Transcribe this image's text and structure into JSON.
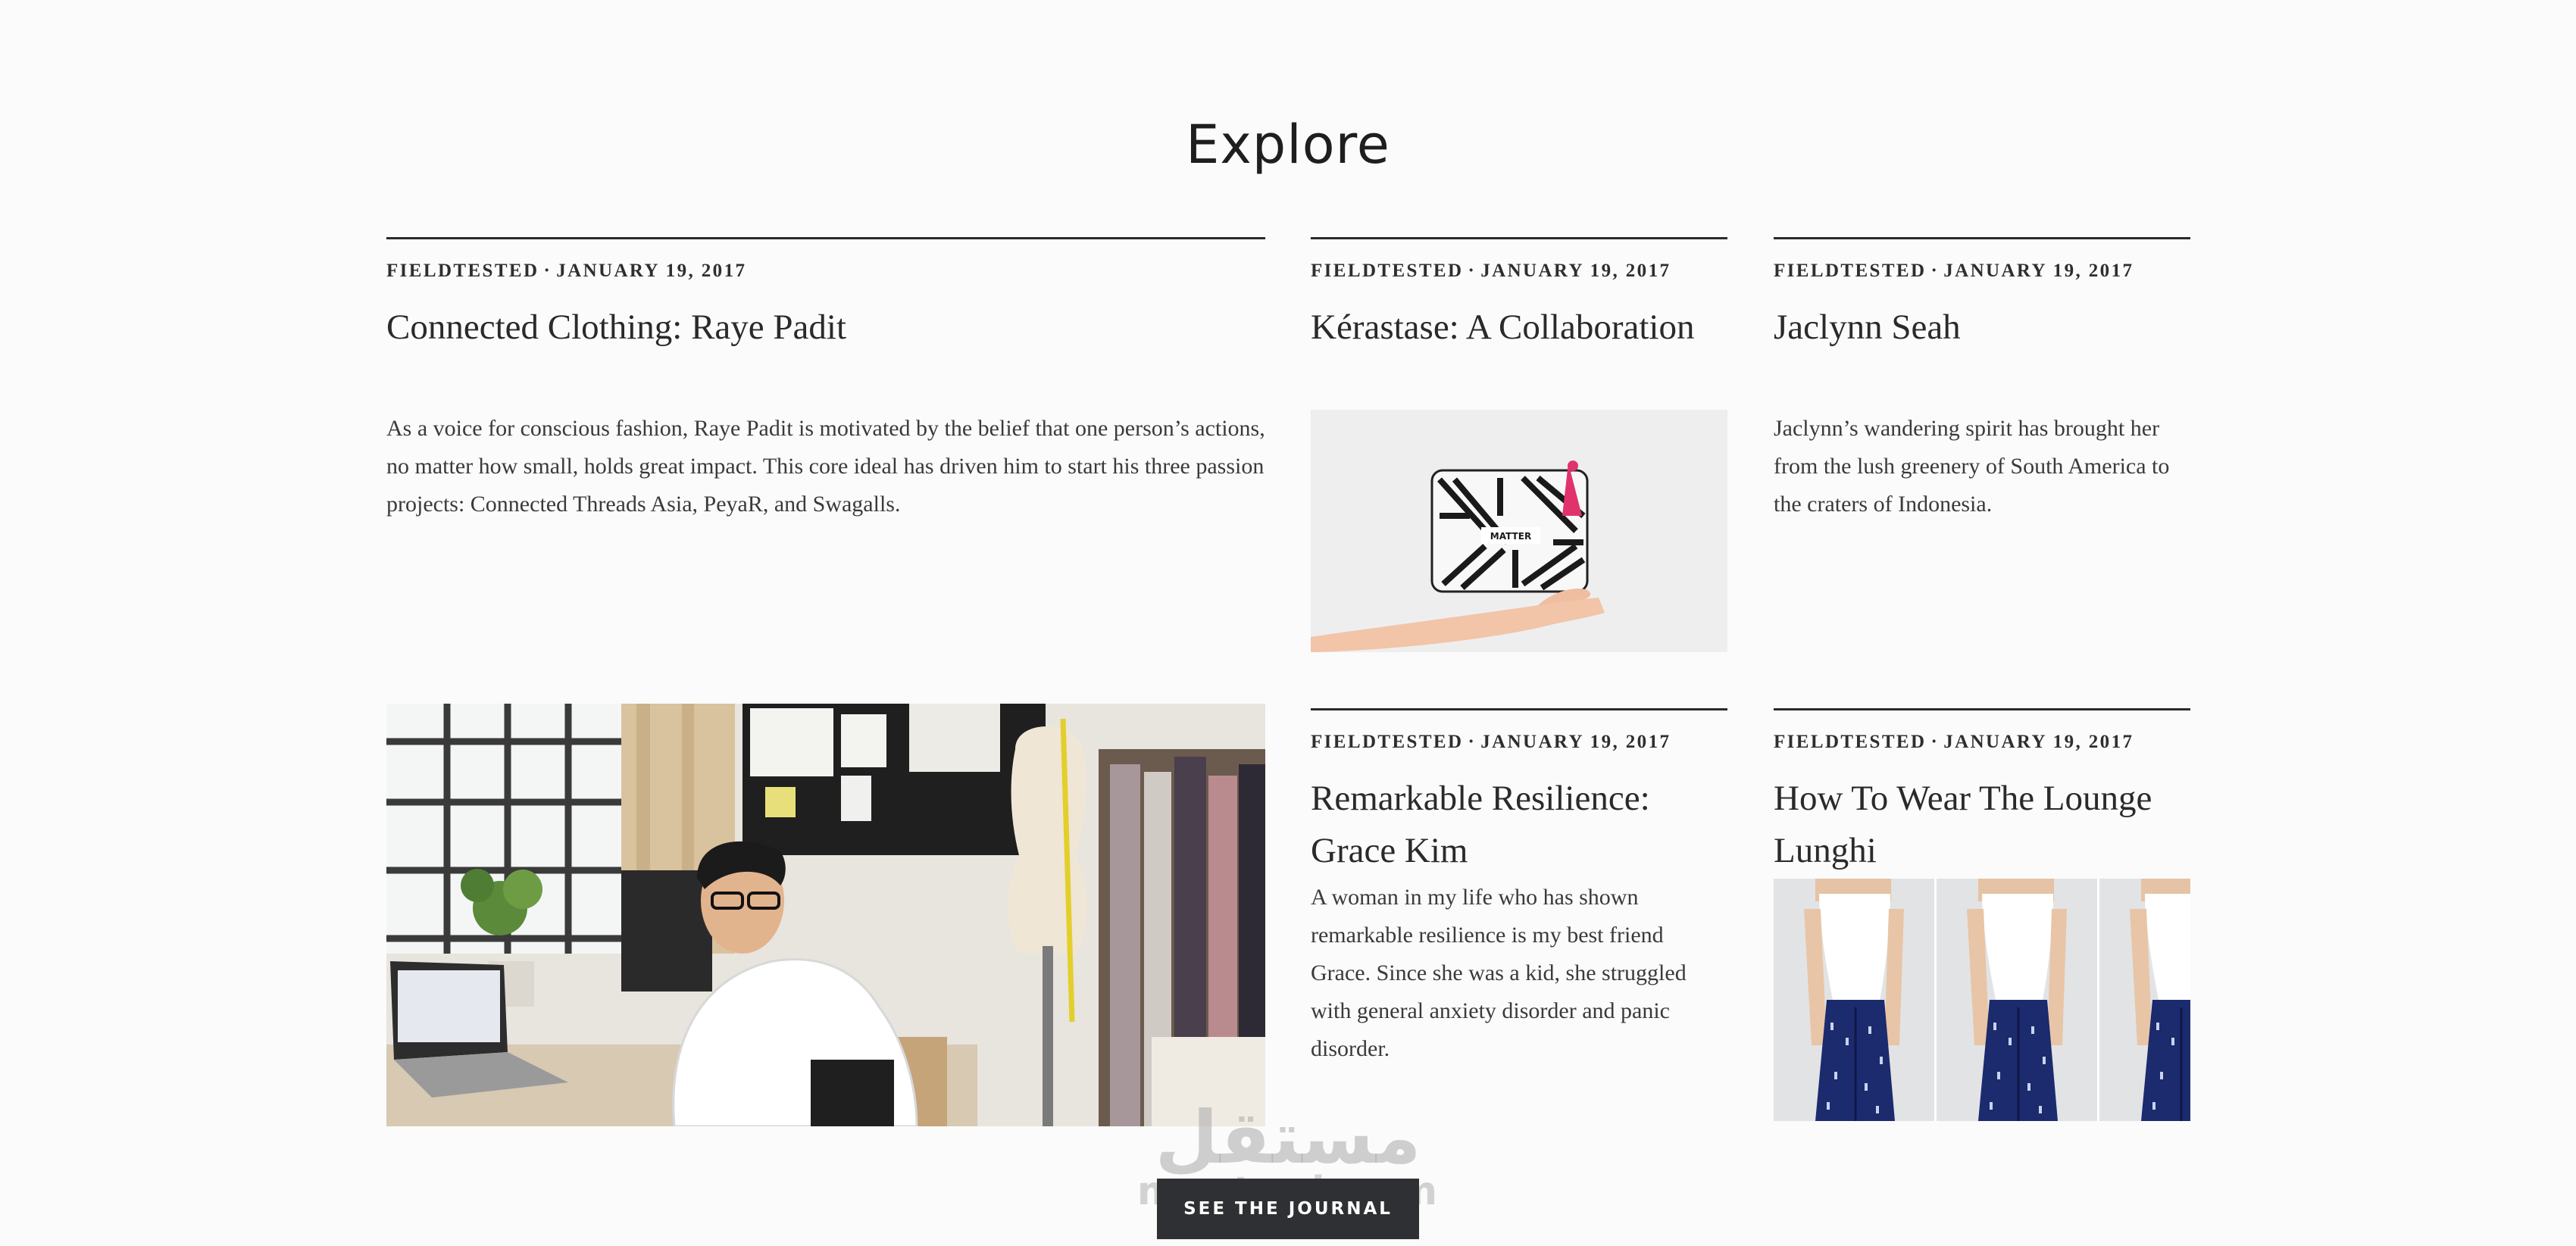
{
  "section": {
    "title": "Explore"
  },
  "articles": [
    {
      "category": "FIELDTESTED",
      "separator": "·",
      "date": "JANUARY 19, 2017",
      "title": "Connected Clothing: Raye Padit",
      "excerpt": "As a voice for conscious fashion, Raye Padit is motivated by the belief that one person’s actions, no matter how small, holds great impact. This core ideal has driven him to start his three passion projects: Connected Threads Asia, PeyaR, and Swagalls."
    },
    {
      "category": "FIELDTESTED",
      "separator": "·",
      "date": "JANUARY 19, 2017",
      "title": "Kérastase: A Collaboration",
      "image": "patterned-pouch-held-by-hand"
    },
    {
      "category": "FIELDTESTED",
      "separator": "·",
      "date": "JANUARY 19, 2017",
      "title": "Jaclynn Seah",
      "excerpt": "Jaclynn’s wandering spirit has brought her from the lush greenery of South America to the craters of Indonesia."
    },
    {
      "image": "man-at-desk-with-dress-form"
    },
    {
      "category": "FIELDTESTED",
      "separator": "·",
      "date": "JANUARY 19, 2017",
      "title": "Remarkable Resilience: Grace Kim",
      "excerpt": "A woman in my life who has shown remarkable resilience is my best friend Grace. Since she was a kid, she struggled with general anxiety disorder and panic disorder."
    },
    {
      "category": "FIELDTESTED",
      "separator": "·",
      "date": "JANUARY 19, 2017",
      "title": "How To Wear The Lounge Lunghi",
      "image": "lunghi-trousers-triptych"
    }
  ],
  "cta": {
    "label": "SEE THE JOURNAL"
  },
  "watermark": {
    "arabic": "مستقل",
    "latin": "mostaql.com"
  },
  "colors": {
    "background": "#fbfbfb",
    "rule": "#2b2b2b",
    "button": "#2f3033",
    "lunghi": "#1c2a6e"
  }
}
